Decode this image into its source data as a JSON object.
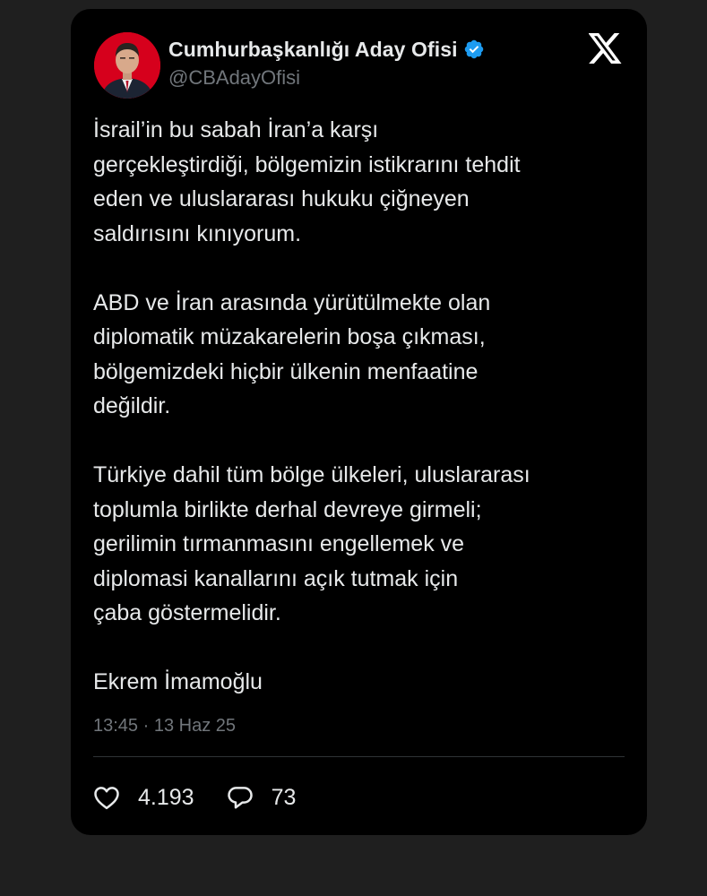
{
  "tweet": {
    "display_name": "Cumhurbaşkanlığı Aday Ofisi",
    "handle": "@CBAdayOfisi",
    "verified_icon": "verified-badge-icon",
    "platform_icon": "x-logo-icon",
    "paragraphs": [
      "İsrail’in bu sabah İran’a karşı\ngerçekleştirdiği, bölgemizin istikrarını tehdit\neden ve uluslararası hukuku çiğneyen\nsaldırısını kınıyorum.",
      "ABD ve İran arasında yürütülmekte olan\ndiplomatik müzakarelerin boşa çıkması,\nbölgemizdeki hiçbir ülkenin menfaatine\ndeğildir.",
      "Türkiye dahil tüm bölge ülkeleri, uluslararası\ntoplumla birlikte derhal devreye girmeli;\ngerilimin tırmanmasını engellemek ve\ndiplomasi kanallarını açık tutmak için\nçaba göstermelidir.",
      "Ekrem İmamoğlu"
    ],
    "timestamp": "13:45 · 13 Haz 25",
    "likes": "4.193",
    "replies": "73"
  },
  "colors": {
    "background": "#1f1f1f",
    "card": "#000000",
    "text": "#e7e9ea",
    "muted": "#71767b",
    "verified": "#1d9bf0",
    "avatar_bg": "#d6001c"
  }
}
